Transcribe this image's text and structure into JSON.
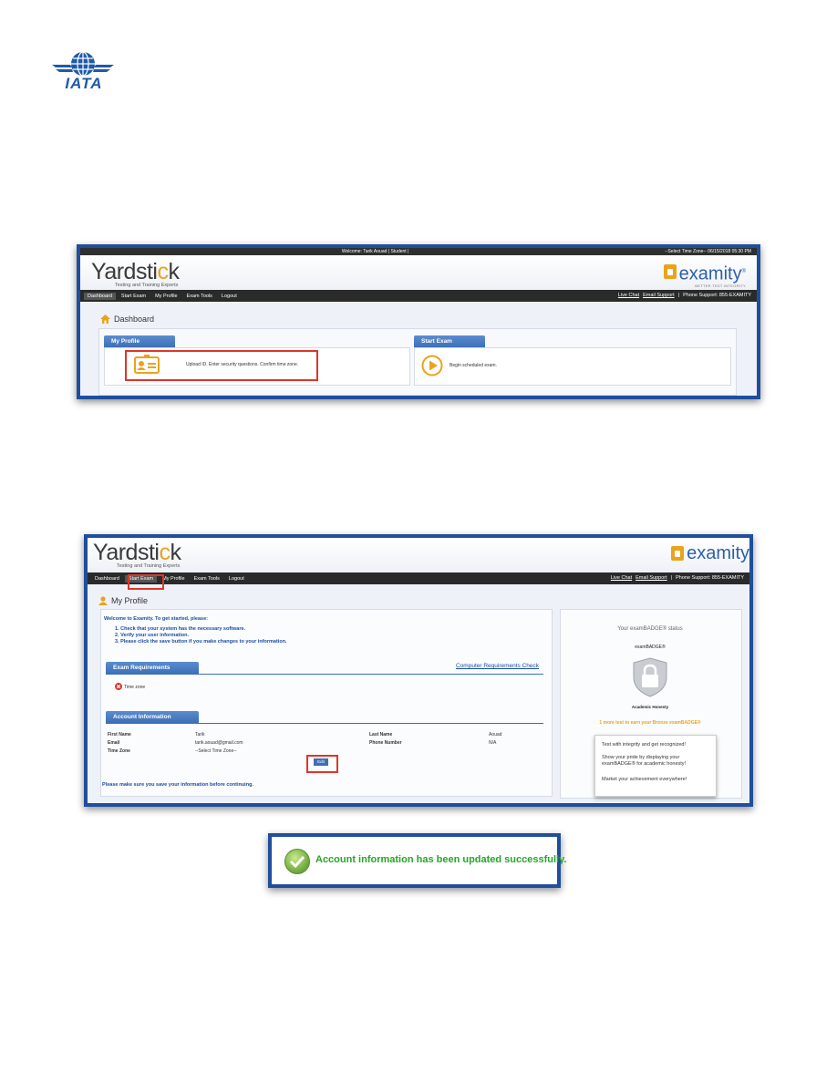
{
  "logo": {
    "text": "IATA"
  },
  "shot1": {
    "topbar_welcome": "Welcome: Tarik Aouad | Student |",
    "topbar_right": "--Select Time Zone-- 06/15/2018 05:30 PM",
    "brand_main_1": "Yardsti",
    "brand_main_2": "c",
    "brand_main_3": "k",
    "brand_sub": "Testing and Training Experts",
    "examity_word": "examity",
    "examity_reg": "®",
    "examity_tag": "BETTER TEST INTEGRITY",
    "nav": [
      "Dashboard",
      "Start Exam",
      "My Profile",
      "Exam Tools",
      "Logout"
    ],
    "nav_right": {
      "live_chat": "Live Chat",
      "email_support": "Email Support",
      "sep": "|",
      "phone": "Phone Support: 855-EXAMITY"
    },
    "page_title": "Dashboard",
    "profile_tab": "My Profile",
    "profile_text": "Upload ID. Enter security questions. Confirm time zone.",
    "start_tab": "Start Exam",
    "start_text": "Begin scheduled exam."
  },
  "shot2": {
    "brand_main_1": "Yardsti",
    "brand_main_2": "c",
    "brand_main_3": "k",
    "brand_sub": "Testing and Training Experts",
    "examity_word": "examity",
    "nav": [
      "Dashboard",
      "Start Exam",
      "My Profile",
      "Exam Tools",
      "Logout"
    ],
    "nav_right": {
      "live_chat": "Live Chat",
      "email_support": "Email Support",
      "sep": "|",
      "phone": "Phone Support: 855-EXAMITY"
    },
    "page_title": "My Profile",
    "welcome": "Welcome to Examity. To get started, please:",
    "steps": [
      "1. Check that your system has the necessary software.",
      "2. Verify your user information.",
      "3. Please click the save button if you make changes to your information."
    ],
    "exam_req_tab": "Exam Requirements",
    "computer_req_link": "Computer Requirements Check",
    "time_zone_item": "Time zone",
    "account_tab": "Account Information",
    "fields": {
      "first_name_label": "First Name",
      "first_name": "Tarik",
      "email_label": "Email",
      "email": "tarik.aouad@gmail.com",
      "tz_label": "Time Zone",
      "tz": "--Select Time Zone--",
      "last_name_label": "Last Name",
      "last_name": "Aouad",
      "phone_label": "Phone Number",
      "phone": "N/A"
    },
    "save_button": "Edit",
    "footer_note": "Please make sure you save your information before continuing.",
    "badge": {
      "title": "Your examBADGE® status",
      "name": "examBADGE®",
      "caption": "Academic Honesty",
      "earn_line": "1 more test to earn your Bronze examBADGE®",
      "card_1": "Test with integrity and get recognized!",
      "card_2": "Show your pride by displaying your examBADGE® for academic honesty!",
      "card_3": "Market your achievement everywhere!"
    }
  },
  "success": {
    "message": "Account information has been updated successfully."
  },
  "colors": {
    "frame": "#1f4e9c",
    "highlight": "#e0342a",
    "brand_blue": "#2d5fa8",
    "brand_orange": "#e9a31d",
    "success_green": "#27a52a"
  }
}
